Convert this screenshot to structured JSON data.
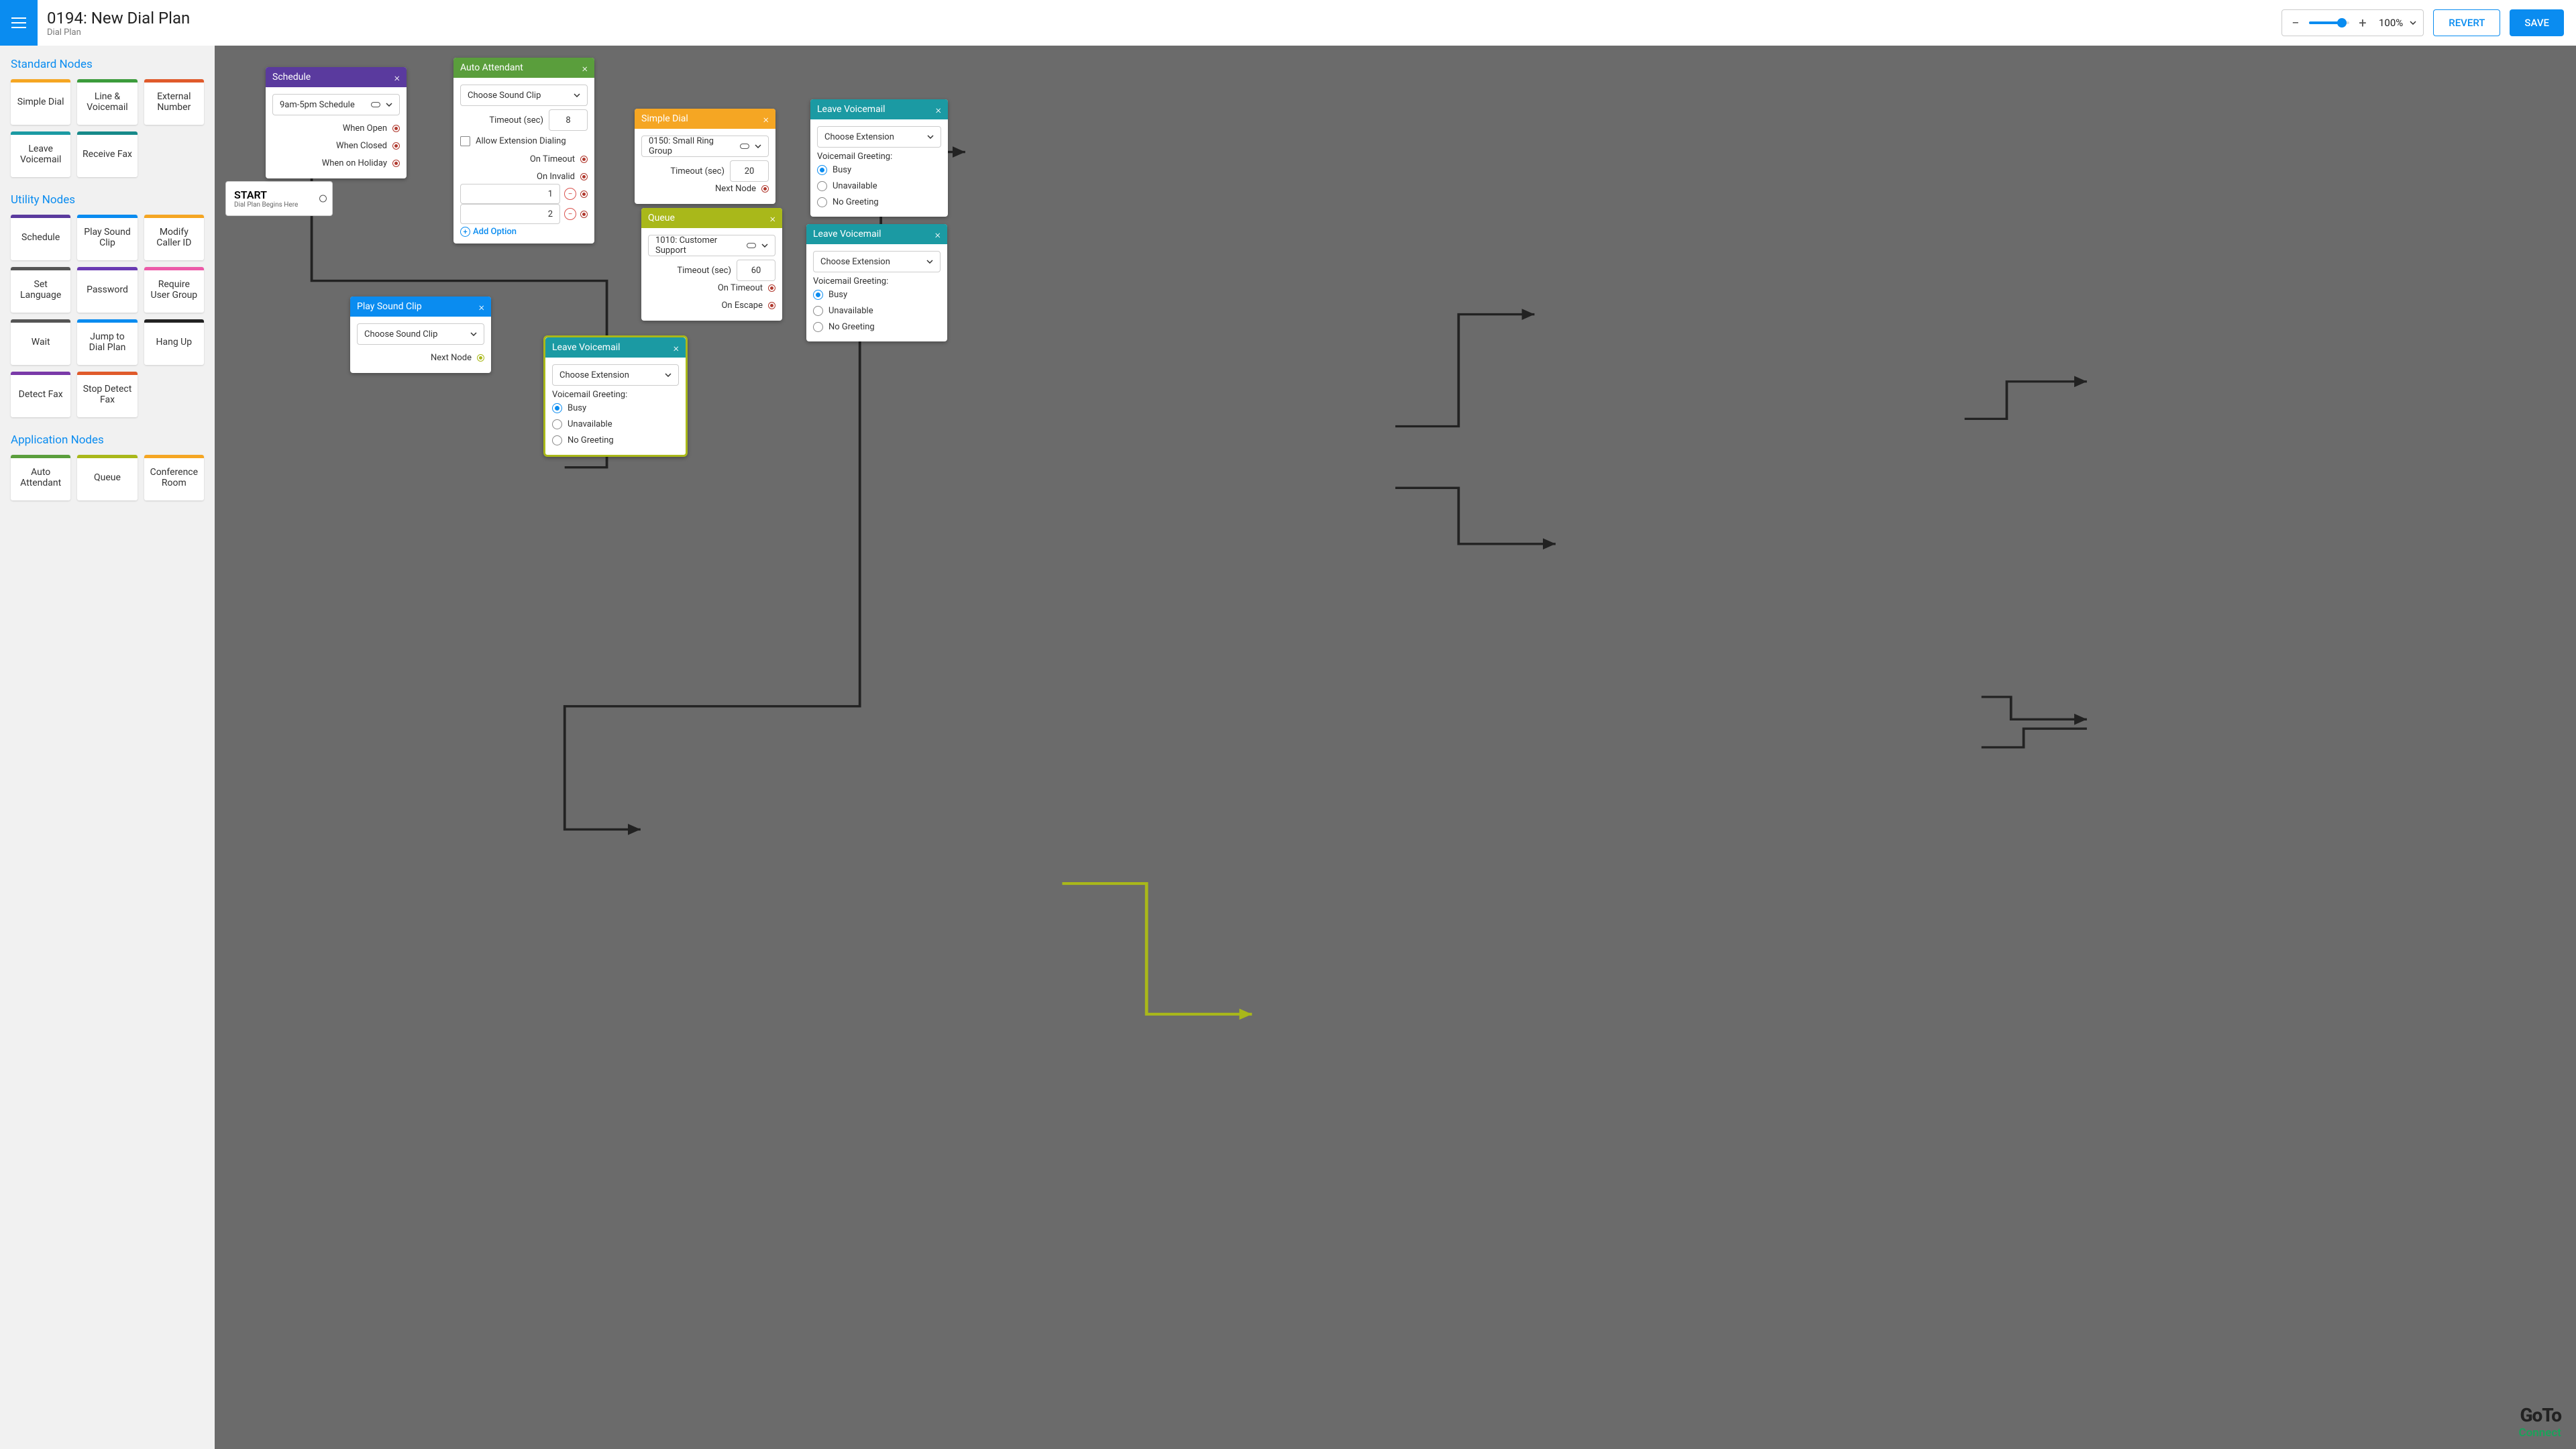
{
  "header": {
    "title": "0194: New Dial Plan",
    "subtitle": "Dial Plan",
    "zoom": "100%",
    "revert": "REVERT",
    "save": "SAVE"
  },
  "sidebar": {
    "standard_title": "Standard Nodes",
    "utility_title": "Utility Nodes",
    "application_title": "Application Nodes",
    "standard": [
      {
        "label": "Simple Dial",
        "color": "#f5a623"
      },
      {
        "label": "Line & Voicemail",
        "color": "#3c9c3c"
      },
      {
        "label": "External Number",
        "color": "#e05a2b"
      },
      {
        "label": "Leave Voicemail",
        "color": "#1b9aa3"
      },
      {
        "label": "Receive Fax",
        "color": "#178a8a"
      }
    ],
    "utility": [
      {
        "label": "Schedule",
        "color": "#5a3a9e"
      },
      {
        "label": "Play Sound Clip",
        "color": "#0a8cf0"
      },
      {
        "label": "Modify Caller ID",
        "color": "#f5a623"
      },
      {
        "label": "Set Language",
        "color": "#555"
      },
      {
        "label": "Password",
        "color": "#6a3ab2"
      },
      {
        "label": "Require User Group",
        "color": "#ec5aa8"
      },
      {
        "label": "Wait",
        "color": "#555"
      },
      {
        "label": "Jump to Dial Plan",
        "color": "#0a8cf0"
      },
      {
        "label": "Hang Up",
        "color": "#222"
      },
      {
        "label": "Detect Fax",
        "color": "#7a3aa8"
      },
      {
        "label": "Stop Detect Fax",
        "color": "#e05a2b"
      }
    ],
    "application": [
      {
        "label": "Auto Attendant",
        "color": "#5a9e3c"
      },
      {
        "label": "Queue",
        "color": "#a9b81a"
      },
      {
        "label": "Conference Room",
        "color": "#f5a623"
      }
    ]
  },
  "nodes": {
    "start": {
      "title": "START",
      "sub": "Dial Plan Begins Here"
    },
    "schedule": {
      "title": "Schedule",
      "dropdown": "9am-5pm Schedule",
      "when_open": "When Open",
      "when_closed": "When Closed",
      "when_holiday": "When on Holiday"
    },
    "auto_attendant": {
      "title": "Auto Attendant",
      "sound": "Choose Sound Clip",
      "timeout_label": "Timeout (sec)",
      "timeout_val": "8",
      "allow_ext": "Allow Extension Dialing",
      "on_timeout": "On Timeout",
      "on_invalid": "On Invalid",
      "opt1": "1",
      "opt2": "2",
      "add": "Add Option"
    },
    "simple_dial": {
      "title": "Simple Dial",
      "ext": "0150: Small Ring Group",
      "timeout_label": "Timeout (sec)",
      "timeout_val": "20",
      "next": "Next Node"
    },
    "queue": {
      "title": "Queue",
      "queue": "1010: Customer Support",
      "timeout_label": "Timeout (sec)",
      "timeout_val": "60",
      "on_timeout": "On Timeout",
      "on_escape": "On Escape"
    },
    "play_sound": {
      "title": "Play Sound Clip",
      "sound": "Choose Sound Clip",
      "next": "Next Node"
    },
    "voicemail1": {
      "title": "Leave Voicemail",
      "ext": "Choose Extension",
      "greeting_label": "Voicemail Greeting:",
      "busy": "Busy",
      "unavailable": "Unavailable",
      "no_greeting": "No Greeting"
    },
    "voicemail2": {
      "title": "Leave Voicemail",
      "ext": "Choose Extension",
      "greeting_label": "Voicemail Greeting:",
      "busy": "Busy",
      "unavailable": "Unavailable",
      "no_greeting": "No Greeting"
    },
    "voicemail3": {
      "title": "Leave Voicemail",
      "ext": "Choose Extension",
      "greeting_label": "Voicemail Greeting:",
      "busy": "Busy",
      "unavailable": "Unavailable",
      "no_greeting": "No Greeting"
    }
  },
  "brand": {
    "goto": "GoTo",
    "connect": "Connect"
  }
}
